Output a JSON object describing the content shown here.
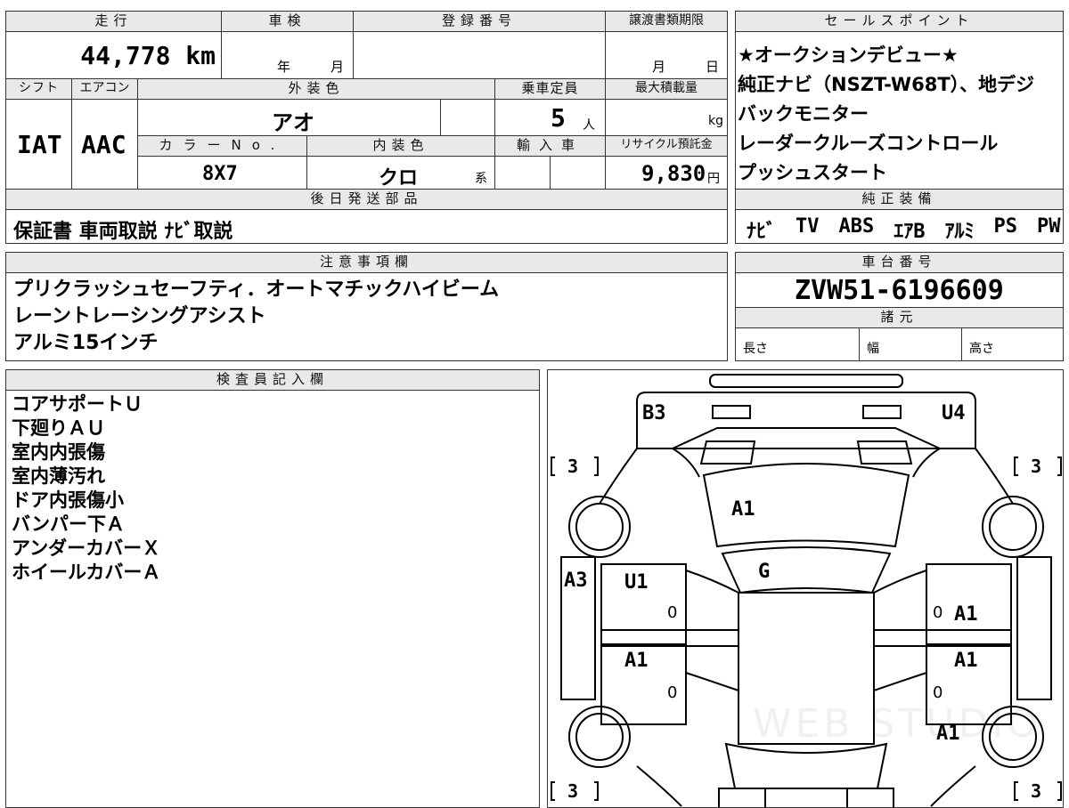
{
  "main": {
    "mileage": {
      "label": "走行",
      "value": "44,778 km"
    },
    "shaken": {
      "label": "車検",
      "year": "年",
      "month": "月"
    },
    "registration": {
      "label": "登録番号"
    },
    "transfer_deadline": {
      "label": "譲渡書類期限",
      "month": "月",
      "day": "日"
    },
    "shift": {
      "label": "シフト",
      "value": "IAT"
    },
    "aircon": {
      "label": "エアコン",
      "value": "AAC"
    },
    "exterior_color": {
      "label": "外装色",
      "value": "アオ"
    },
    "capacity": {
      "label": "乗車定員",
      "value": "5",
      "unit": "人"
    },
    "max_load": {
      "label": "最大積載量",
      "unit": "kg"
    },
    "color_no": {
      "label": "カラーNo.",
      "value": "8X7"
    },
    "interior_color": {
      "label": "内装色",
      "value": "クロ",
      "suffix": "系"
    },
    "import": {
      "label": "輸入車"
    },
    "recycle": {
      "label": "リサイクル預託金",
      "value": "9,830",
      "unit": "円"
    },
    "later_parts": {
      "label": "後日発送部品",
      "value": "保証書 車両取説 ﾅﾋﾞ取説"
    }
  },
  "sales_points": {
    "label": "セールスポイント",
    "items": [
      "★オークションデビュー★",
      "純正ナビ（NSZT-W68T）、地デジ",
      "バックモニター",
      "レーダークルーズコントロール",
      "プッシュスタート"
    ]
  },
  "genuine_equipment": {
    "label": "純正装備",
    "items": [
      "ﾅﾋﾞ",
      "TV",
      "ABS",
      "ｴｱB",
      "ｱﾙﾐ",
      "PS",
      "PW"
    ]
  },
  "notes": {
    "label": "注意事項欄",
    "lines": [
      "プリクラッシュセーフティ．オートマチックハイビーム",
      "レーントレーシングアシスト",
      "アルミ15インチ"
    ]
  },
  "chassis": {
    "label": "車台番号",
    "value": "ZVW51-6196609"
  },
  "specs": {
    "label": "諸元",
    "length": "長さ",
    "width": "幅",
    "height": "高さ"
  },
  "inspector": {
    "label": "検査員記入欄",
    "lines": [
      "コアサポートＵ",
      "下廻りＡＵ",
      "室内内張傷",
      "室内薄汚れ",
      "ドア内張傷小",
      "バンパー下Ａ",
      "アンダーカバーＸ",
      "ホイールカバーＡ"
    ]
  },
  "diagram": {
    "marks": {
      "front_left": "B3",
      "front_right": "U4",
      "hood": "A1",
      "roof_front": "G",
      "left_fender": "A3",
      "left_front_door": "U1",
      "right_front_door": "A1",
      "left_rear_door": "A1",
      "right_rear_door": "A1",
      "right_rear": "A1"
    },
    "wheel_counts": [
      "3",
      "3",
      "3",
      "3"
    ],
    "zeros": [
      "0",
      "0",
      "0",
      "0"
    ],
    "watermark": "WEB STUDIO"
  }
}
